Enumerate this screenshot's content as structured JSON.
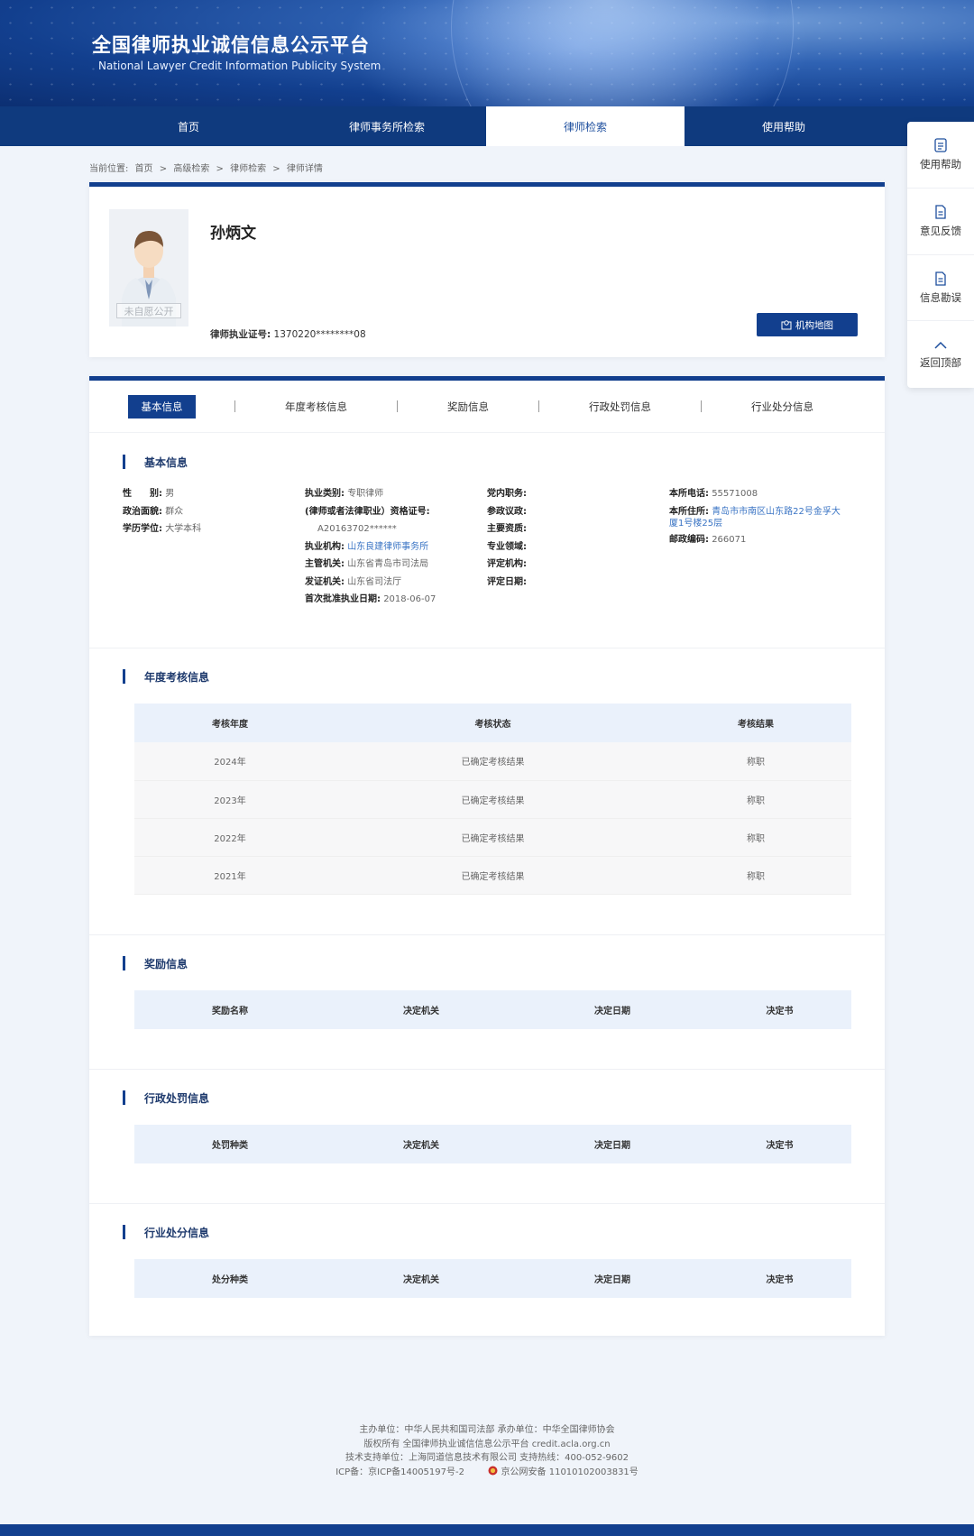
{
  "header": {
    "title": "全国律师执业诚信信息公示平台",
    "subtitle": "National Lawyer Credit Information Publicity System"
  },
  "nav": {
    "items": [
      "首页",
      "律师事务所检索",
      "律师检索",
      "使用帮助"
    ],
    "active_index": 2
  },
  "side_tools": [
    "使用帮助",
    "意见反馈",
    "信息勘误",
    "返回顶部"
  ],
  "breadcrumb": {
    "label": "当前位置:",
    "items": [
      "首页",
      "高级检索",
      "律师检索",
      "律师详情"
    ],
    "separator": ">"
  },
  "profile": {
    "avatar_tag": "未自愿公开",
    "name": "孙炳文",
    "license_label": "律师执业证号:",
    "license_value": "1370220********08",
    "map_button": "机构地图"
  },
  "tabs": {
    "items": [
      "基本信息",
      "年度考核信息",
      "奖励信息",
      "行政处罚信息",
      "行业处分信息"
    ],
    "active_index": 0
  },
  "basic": {
    "title": "基本信息",
    "col1": [
      {
        "k": "性　　别:",
        "v": "男"
      },
      {
        "k": "政治面貌:",
        "v": "群众"
      },
      {
        "k": "学历学位:",
        "v": "大学本科"
      }
    ],
    "col2": [
      {
        "k": "执业类别:",
        "v": "专职律师"
      },
      {
        "k": "(律师或者法律职业）资格证号:",
        "v": ""
      },
      {
        "k": "",
        "v": "A20163702******"
      },
      {
        "k": "执业机构:",
        "v": "山东良建律师事务所"
      },
      {
        "k": "主管机关:",
        "v": "山东省青岛市司法局"
      },
      {
        "k": "发证机关:",
        "v": "山东省司法厅"
      },
      {
        "k": "首次批准执业日期:",
        "v": "2018-06-07"
      }
    ],
    "col3": [
      {
        "k": "党内职务:",
        "v": ""
      },
      {
        "k": "参政议政:",
        "v": ""
      },
      {
        "k": "主要资质:",
        "v": ""
      },
      {
        "k": "专业领域:",
        "v": ""
      },
      {
        "k": "评定机构:",
        "v": ""
      },
      {
        "k": "评定日期:",
        "v": ""
      }
    ],
    "col4": [
      {
        "k": "本所电话:",
        "v": "55571008"
      },
      {
        "k": "本所住所:",
        "v": "青岛市市南区山东路22号金孚大"
      },
      {
        "k": "",
        "v": "厦1号楼25层"
      },
      {
        "k": "邮政编码:",
        "v": "266071"
      }
    ]
  },
  "annual": {
    "title": "年度考核信息",
    "headers": [
      "考核年度",
      "考核状态",
      "考核结果"
    ],
    "rows": [
      [
        "2024年",
        "已确定考核结果",
        "称职"
      ],
      [
        "2023年",
        "已确定考核结果",
        "称职"
      ],
      [
        "2022年",
        "已确定考核结果",
        "称职"
      ],
      [
        "2021年",
        "已确定考核结果",
        "称职"
      ]
    ]
  },
  "reward": {
    "title": "奖励信息",
    "headers": [
      "奖励名称",
      "决定机关",
      "决定日期",
      "决定书"
    ]
  },
  "admin_penalty": {
    "title": "行政处罚信息",
    "headers": [
      "处罚种类",
      "决定机关",
      "决定日期",
      "决定书"
    ]
  },
  "industry_penalty": {
    "title": "行业处分信息",
    "headers": [
      "处分种类",
      "决定机关",
      "决定日期",
      "决定书"
    ]
  },
  "footer": {
    "line1": "主办单位：中华人民共和国司法部 承办单位：中华全国律师协会",
    "line2": "版权所有 全国律师执业诚信信息公示平台 credit.acla.org.cn",
    "line3": "技术支持单位：上海同道信息技术有限公司 支持热线：400-052-9602",
    "icp": "ICP备：京ICP备14005197号-2",
    "police": "京公网安备 11010102003831号"
  },
  "colors": {
    "primary": "#123f8e",
    "link": "#3a74c4",
    "table_header": "#eaf1fb"
  }
}
